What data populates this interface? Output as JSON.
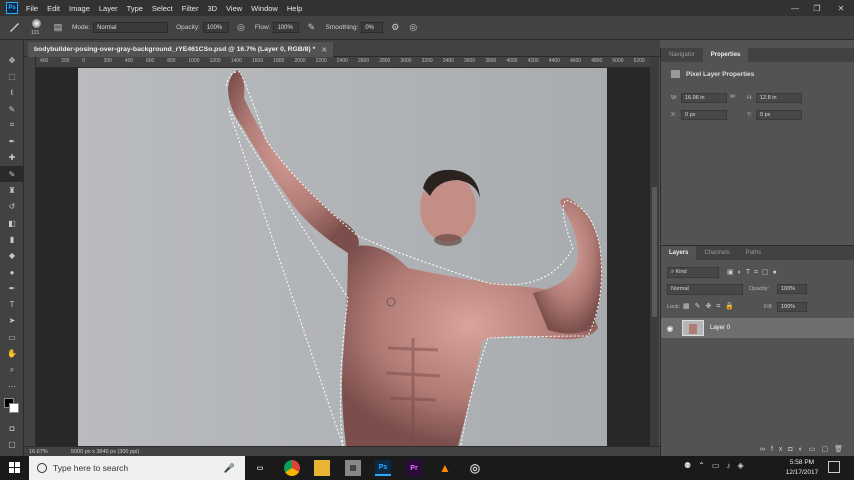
{
  "menubar": {
    "logo": "Ps",
    "items": [
      "File",
      "Edit",
      "Image",
      "Layer",
      "Type",
      "Select",
      "Filter",
      "3D",
      "View",
      "Window",
      "Help"
    ],
    "controls": {
      "minimize": "—",
      "restore": "❐",
      "close": "✕"
    }
  },
  "options": {
    "brush_size": "121",
    "mode_label": "Mode:",
    "mode_value": "Normal",
    "opacity_label": "Opacity:",
    "opacity_value": "100%",
    "flow_label": "Flow:",
    "flow_value": "100%",
    "smoothing_label": "Smoothing:",
    "smoothing_value": "0%"
  },
  "document": {
    "tab_title": "bodybuilder-posing-over-gray-background_rYE461CSo.psd @ 16.7% (Layer 0, RGB/8) *",
    "zoom": "16.67%",
    "doc_info": "5000 px x 3840 px (300 ppi)",
    "ruler_ticks": [
      "400",
      "200",
      "0",
      "200",
      "400",
      "600",
      "800",
      "1000",
      "1200",
      "1400",
      "1600",
      "1800",
      "2000",
      "2200",
      "2400",
      "2600",
      "2800",
      "3000",
      "3200",
      "3400",
      "3600",
      "3800",
      "4000",
      "4200",
      "4400",
      "4600",
      "4800",
      "5000",
      "5200"
    ]
  },
  "properties": {
    "tabs": [
      "Navigator",
      "Properties"
    ],
    "active_tab": "Properties",
    "heading": "Pixel Layer Properties",
    "w_label": "W:",
    "w_value": "16.96 in",
    "h_label": "H:",
    "h_value": "12.8 in",
    "x_label": "X:",
    "x_value": "0 px",
    "y_label": "Y:",
    "y_value": "0 px"
  },
  "layers": {
    "tabs": [
      "Layers",
      "Channels",
      "Paths"
    ],
    "active_tab": "Layers",
    "filter_kind": "Kind",
    "blend_mode": "Normal",
    "opacity_label": "Opacity:",
    "opacity_value": "100%",
    "lock_label": "Lock:",
    "fill_label": "Fill:",
    "fill_value": "100%",
    "items": [
      {
        "name": "Layer 0",
        "visible": true
      }
    ]
  },
  "taskbar": {
    "search_placeholder": "Type here to search",
    "time": "5:58 PM",
    "date": "12/17/2017",
    "apps": [
      "Ps",
      "Pr"
    ]
  },
  "colors": {
    "accent": "#31a8ff",
    "ui_dark": "#424242",
    "ui_mid": "#535353",
    "premiere": "#ea77ff"
  }
}
